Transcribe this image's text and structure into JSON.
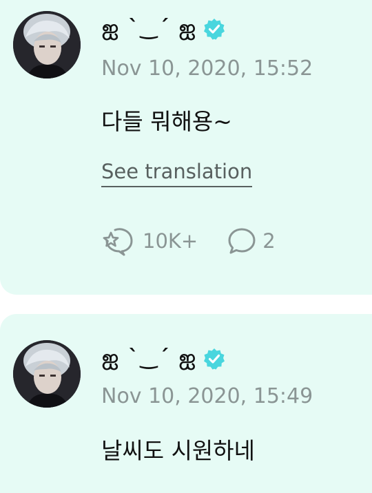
{
  "posts": [
    {
      "author_name": "ஐ ˋ‿ˊ ஐ",
      "verified_badge": "verified-check-icon",
      "date": "Nov 10, 2020, 15:52",
      "body": "다들 뭐해용~",
      "translate_label": "See translation",
      "like_icon": "star-bubble-icon",
      "like_count": "10K+",
      "comment_icon": "comment-bubble-icon",
      "comment_count": "2"
    },
    {
      "author_name": "ஐ ˋ‿ˊ ஐ",
      "verified_badge": "verified-check-icon",
      "date": "Nov 10, 2020, 15:49",
      "body": "날씨도 시원하네"
    }
  ],
  "colors": {
    "card_background": "#e6fbf5",
    "verified": "#49d6de",
    "muted_text": "#8a9594",
    "body_text": "#111111"
  }
}
